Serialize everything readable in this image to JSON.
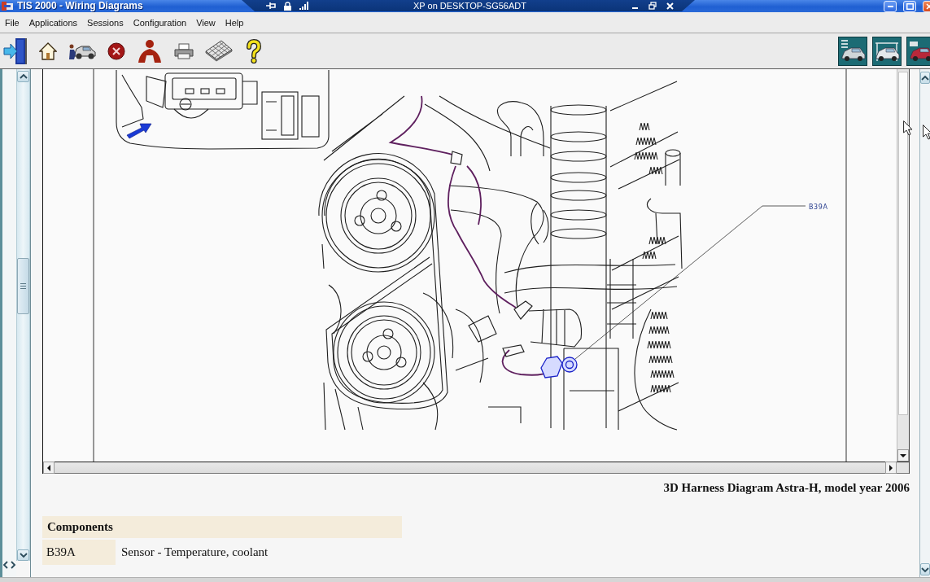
{
  "window": {
    "title": "TIS 2000 - Wiring Diagrams"
  },
  "remote_session": {
    "title": "XP on DESKTOP-SG56ADT"
  },
  "menu": [
    "File",
    "Applications",
    "Sessions",
    "Configuration",
    "View",
    "Help"
  ],
  "diagram": {
    "callout": "B39A",
    "caption": "3D Harness Diagram Astra-H, model year 2006"
  },
  "components": {
    "title": "Components",
    "rows": [
      {
        "code": "B39A",
        "description": "Sensor - Temperature, coolant"
      }
    ]
  }
}
